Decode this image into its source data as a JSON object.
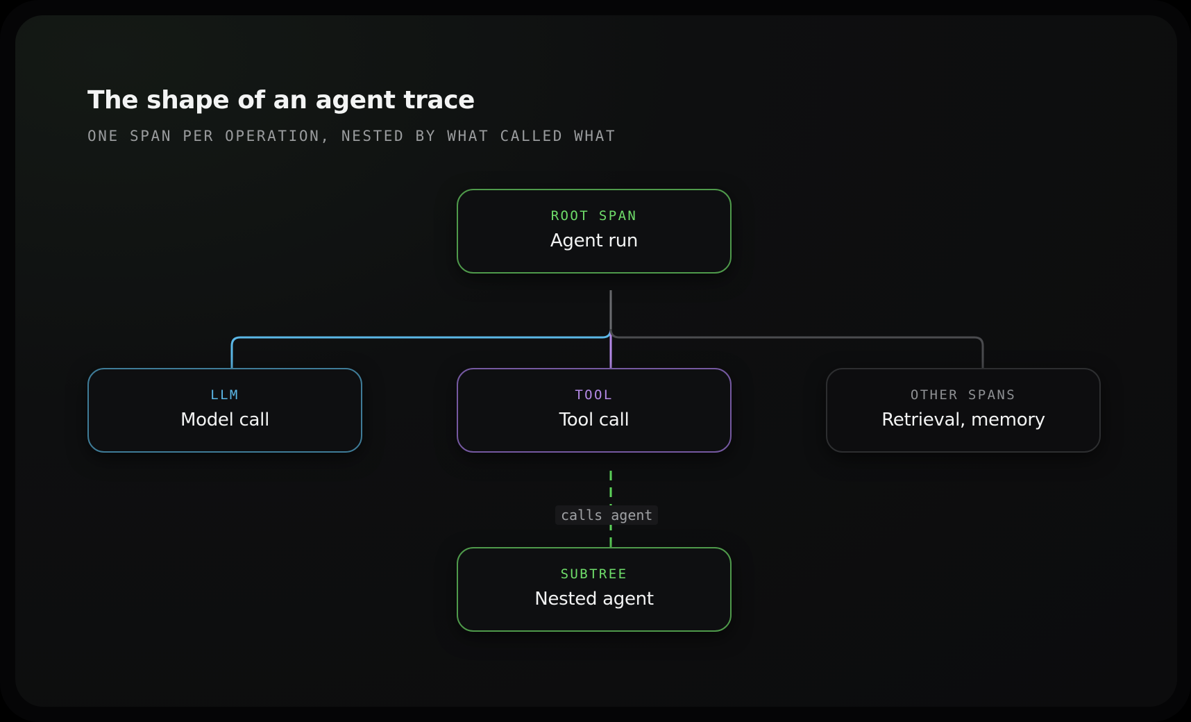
{
  "diagram": {
    "title": "The shape of an agent trace",
    "subtitle": "ONE SPAN PER OPERATION, NESTED BY WHAT CALLED WHAT",
    "nodes": {
      "root": {
        "kind": "ROOT SPAN",
        "label": "Agent run"
      },
      "llm": {
        "kind": "LLM",
        "label": "Model call"
      },
      "tool": {
        "kind": "TOOL",
        "label": "Tool call"
      },
      "other": {
        "kind": "OTHER SPANS",
        "label": "Retrieval, memory"
      },
      "nested": {
        "kind": "SUBTREE",
        "label": "Nested agent"
      }
    },
    "edge_label": "calls agent"
  },
  "colors": {
    "root": "#6fdd6a",
    "llm": "#5bb7e6",
    "tool": "#b58ae8",
    "other": "#8e9093",
    "subtree": "#6fdd6a",
    "trunk": "#6b6c70"
  }
}
